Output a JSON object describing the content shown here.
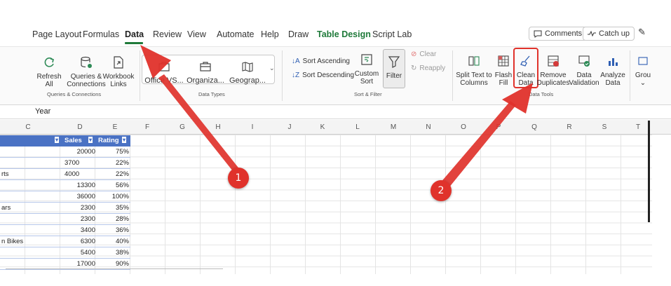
{
  "tabs": [
    "Page Layout",
    "Formulas",
    "Data",
    "Review",
    "View",
    "Automate",
    "Help",
    "Draw",
    "Table Design",
    "Script Lab"
  ],
  "active_tab": "Data",
  "header_buttons": {
    "comments": "Comments",
    "catchup": "Catch up"
  },
  "queries": {
    "refresh": [
      "Refresh",
      "All"
    ],
    "queries_connections": [
      "Queries &",
      "Connections"
    ],
    "workbook_links": [
      "Workbook",
      "Links"
    ],
    "group_label": "Queries & Connections"
  },
  "data_types": {
    "items": [
      "Office VS...",
      "Organiza...",
      "Geograp..."
    ],
    "group_label": "Data Types"
  },
  "sort_filter": {
    "sort_ascending": "Sort Ascending",
    "sort_descending": "Sort Descending",
    "custom_sort": [
      "Custom",
      "Sort"
    ],
    "filter": "Filter",
    "clear": "Clear",
    "reapply": "Reapply",
    "group_label": "Sort & Filter"
  },
  "data_tools": {
    "split_text": [
      "Split Text to",
      "Columns"
    ],
    "flash_fill": [
      "Flash",
      "Fill"
    ],
    "clean_data": [
      "Clean",
      "Data"
    ],
    "remove_duplicates": [
      "Remove",
      "Duplicates"
    ],
    "data_validation": [
      "Data",
      "Validation"
    ],
    "analyze_data": [
      "Analyze",
      "Data"
    ],
    "group": "Grou",
    "group_label": "Data Tools"
  },
  "formula_bar": {
    "value": "Year"
  },
  "columns": [
    "C",
    "D",
    "E",
    "F",
    "G",
    "H",
    "I",
    "J",
    "K",
    "L",
    "M",
    "N",
    "O",
    "P",
    "Q",
    "R",
    "S",
    "T"
  ],
  "table": {
    "headers": {
      "sales": "Sales",
      "rating": "Rating"
    },
    "rows": [
      {
        "c": "",
        "sales": "20000",
        "rating": "75%"
      },
      {
        "c": "",
        "sales": "3700",
        "rating": "22%"
      },
      {
        "c": "rts",
        "sales": "4000",
        "rating": "22%"
      },
      {
        "c": "",
        "sales": "13300",
        "rating": "56%"
      },
      {
        "c": "",
        "sales": "36000",
        "rating": "100%"
      },
      {
        "c": "ars",
        "sales": "2300",
        "rating": "35%"
      },
      {
        "c": "",
        "sales": "2300",
        "rating": "28%"
      },
      {
        "c": "",
        "sales": "3400",
        "rating": "36%"
      },
      {
        "c": "n Bikes",
        "sales": "6300",
        "rating": "40%"
      },
      {
        "c": "",
        "sales": "5400",
        "rating": "38%"
      },
      {
        "c": "",
        "sales": "17000",
        "rating": "90%"
      }
    ]
  },
  "annotations": {
    "badge1": "1",
    "badge2": "2"
  },
  "colors": {
    "accent_green": "#1f7a3a",
    "table_header": "#4a72c4",
    "annotation_red": "#e0322b"
  }
}
